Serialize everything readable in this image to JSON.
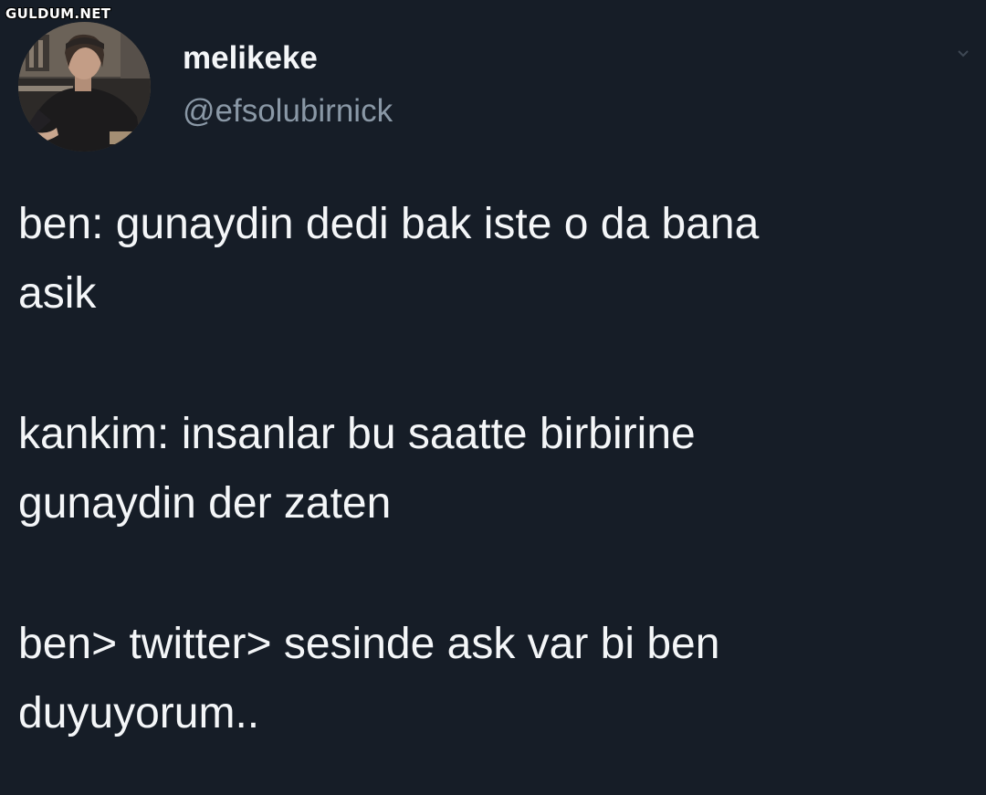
{
  "watermark": "GULDUM.NET",
  "user": {
    "display_name": "melikeke",
    "handle": "@efsolubirnick"
  },
  "tweet": {
    "paragraphs": [
      {
        "lines": [
          "ben: gunaydin dedi bak iste o da bana",
          "asik"
        ]
      },
      {
        "lines": [
          "kankim: insanlar bu saatte birbirine",
          "gunaydin der zaten"
        ]
      },
      {
        "lines": [
          "ben> twitter> sesinde ask var bi ben",
          "duyuyorum.."
        ]
      }
    ]
  },
  "icons": {
    "caret": "chevron-down-icon",
    "avatar": "profile-photo"
  },
  "colors": {
    "background": "#161d27",
    "text": "#f4f6f8",
    "secondary_text": "#8a98a6"
  }
}
